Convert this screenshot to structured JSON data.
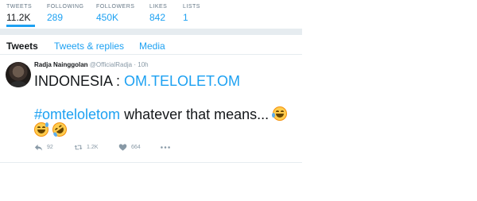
{
  "stats": [
    {
      "label": "TWEETS",
      "value": "11.2K"
    },
    {
      "label": "FOLLOWING",
      "value": "289"
    },
    {
      "label": "FOLLOWERS",
      "value": "450K"
    },
    {
      "label": "LIKES",
      "value": "842"
    },
    {
      "label": "LISTS",
      "value": "1"
    }
  ],
  "tabs": [
    {
      "label": "Tweets",
      "active": true
    },
    {
      "label": "Tweets & replies",
      "active": false
    },
    {
      "label": "Media",
      "active": false
    }
  ],
  "tweet": {
    "author_name": "Radja Nainggolan",
    "author_handle": "@OfficialRadja",
    "separator": "·",
    "time": "10h",
    "line1_prefix": "INDONESIA : ",
    "line1_link": "OM.TELOLET.OM",
    "hashtag": "#omteloletom",
    "line2_text": " whatever that means...",
    "emojis": [
      "face-with-tears-of-joy",
      "grinning-sweat-face",
      "rolling-on-floor-laughing"
    ],
    "actions": {
      "replies": "92",
      "retweets": "1.2K",
      "likes": "664"
    }
  },
  "colors": {
    "accent": "#1da1f2",
    "text": "#14171a",
    "muted": "#8899a6",
    "border": "#e6ecf0"
  }
}
